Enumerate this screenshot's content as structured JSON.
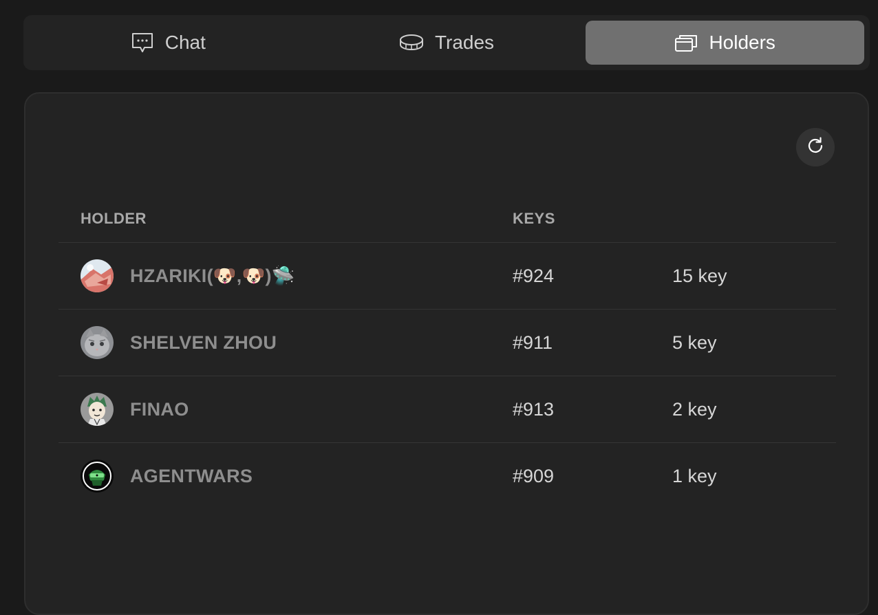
{
  "tabs": [
    {
      "label": "Chat",
      "icon": "chat-icon",
      "active": false
    },
    {
      "label": "Trades",
      "icon": "coin-icon",
      "active": false
    },
    {
      "label": "Holders",
      "icon": "cards-icon",
      "active": true
    }
  ],
  "refresh": {
    "icon": "refresh-icon"
  },
  "table": {
    "headers": {
      "holder": "HOLDER",
      "keys": "KEYS"
    },
    "rows": [
      {
        "name": "HZARIKI(🐶,🐶)🛸",
        "key_id": "#924",
        "amount": "15 key"
      },
      {
        "name": "SHELVEN ZHOU",
        "key_id": "#911",
        "amount": "5 key"
      },
      {
        "name": "FINAO",
        "key_id": "#913",
        "amount": "2 key"
      },
      {
        "name": "AGENTWARS",
        "key_id": "#909",
        "amount": "1 key"
      }
    ]
  },
  "colors": {
    "background": "#1a1a1a",
    "panel": "#232323",
    "active_tab": "#707070",
    "holder_name": "#8e8e8e"
  }
}
